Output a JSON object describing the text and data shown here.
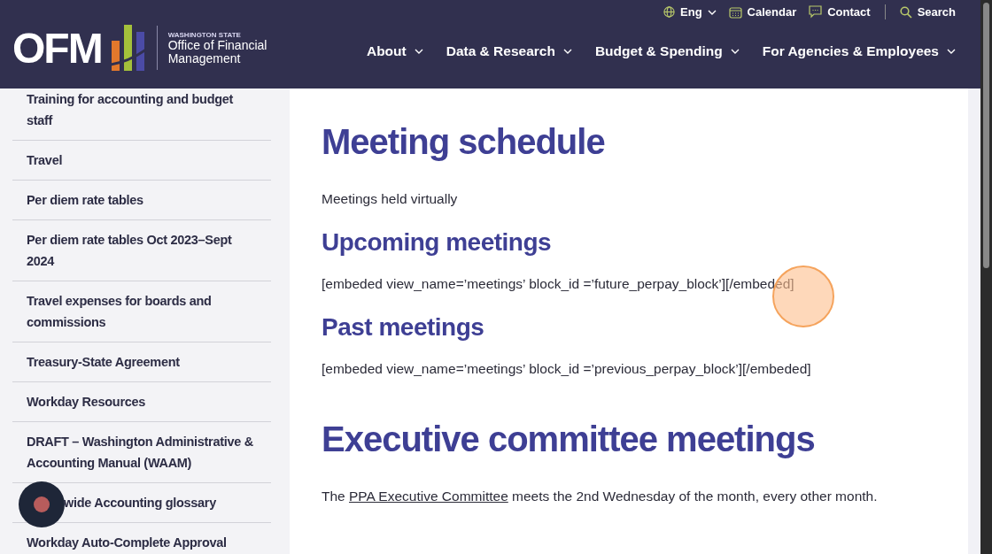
{
  "header": {
    "logo": {
      "letters": "OFM",
      "state": "WASHINGTON STATE",
      "name": "Office of Financial Management"
    },
    "utility": [
      {
        "kind": "language",
        "label": "Eng"
      },
      {
        "kind": "calendar",
        "label": "Calendar"
      },
      {
        "kind": "contact",
        "label": "Contact"
      },
      {
        "kind": "search",
        "label": "Search"
      }
    ],
    "nav": [
      {
        "label": "About"
      },
      {
        "label": "Data & Research"
      },
      {
        "label": "Budget & Spending"
      },
      {
        "label": "For Agencies & Employees"
      }
    ]
  },
  "sidebar": {
    "items": [
      {
        "label": "Training for accounting and budget staff"
      },
      {
        "label": "Travel"
      },
      {
        "label": "Per diem rate tables"
      },
      {
        "label": "Per diem rate tables Oct 2023–Sept 2024"
      },
      {
        "label": "Travel expenses for boards and commissions"
      },
      {
        "label": "Treasury-State Agreement"
      },
      {
        "label": "Workday Resources"
      },
      {
        "label": "DRAFT – Washington Administrative & Accounting Manual (WAAM)"
      },
      {
        "label": "wide Accounting glossary"
      },
      {
        "label": "Workday Auto-Complete Approval"
      }
    ]
  },
  "content": {
    "title": "Meeting schedule",
    "blocks": [
      {
        "kind": "p",
        "text": "Meetings held virtually"
      },
      {
        "kind": "h2",
        "text": "Upcoming meetings"
      },
      {
        "kind": "p",
        "text": "[embeded view_name=’meetings’ block_id =’future_perpay_block’][/embeded]"
      },
      {
        "kind": "h2",
        "text": "Past meetings"
      },
      {
        "kind": "p",
        "text": "[embeded view_name=’meetings’ block_id =’previous_perpay_block’][/embeded]"
      },
      {
        "kind": "h1",
        "text": "Executive committee meetings"
      },
      {
        "kind": "link_p",
        "before": "The ",
        "link": "PPA Executive Committee",
        "after": " meets the 2nd Wednesday of the month, every other month."
      }
    ]
  }
}
